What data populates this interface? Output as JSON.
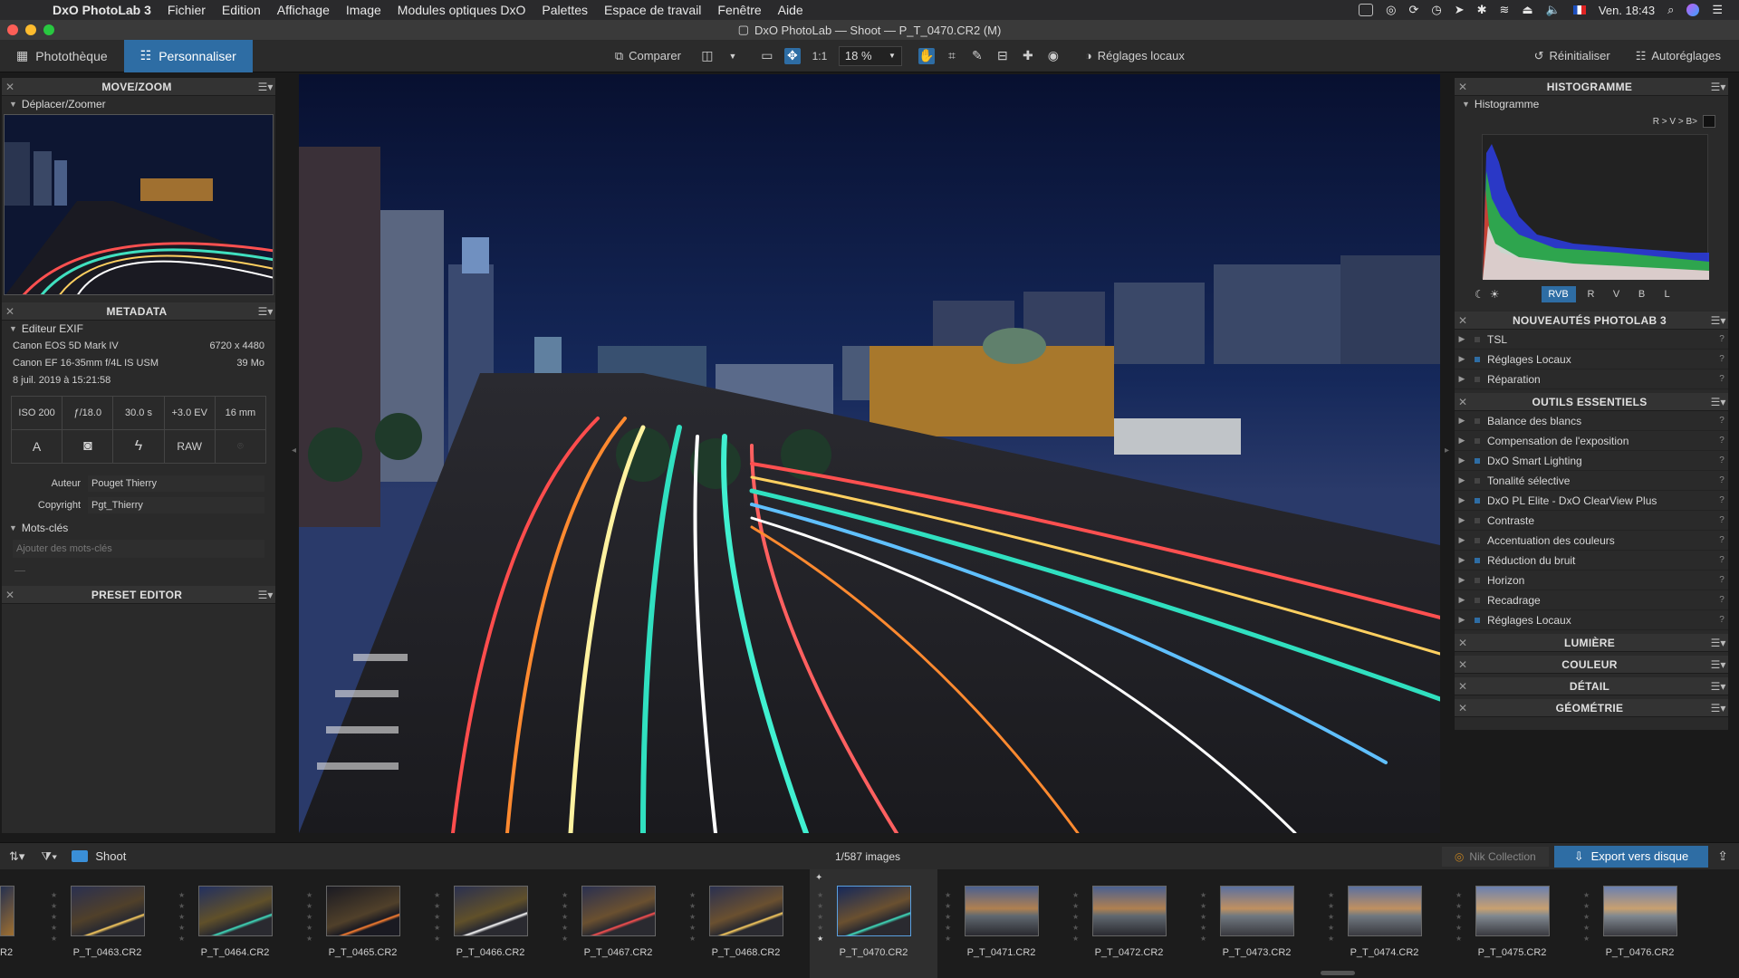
{
  "menubar": {
    "app_name": "DxO PhotoLab 3",
    "items": [
      "Fichier",
      "Edition",
      "Affichage",
      "Image",
      "Modules optiques DxO",
      "Palettes",
      "Espace de travail",
      "Fenêtre",
      "Aide"
    ],
    "clock": "Ven. 18:43"
  },
  "window": {
    "title": "DxO PhotoLab — Shoot — P_T_0470.CR2 (M)"
  },
  "toolbar": {
    "tab_library": "Photothèque",
    "tab_customize": "Personnaliser",
    "compare_label": "Comparer",
    "ratio_label": "1:1",
    "zoom_value": "18 %",
    "local_adjust_label": "Réglages locaux",
    "reset_label": "Réinitialiser",
    "auto_label": "Autoréglages"
  },
  "left": {
    "move_zoom_title": "MOVE/ZOOM",
    "move_zoom_sub": "Déplacer/Zoomer",
    "metadata_title": "METADATA",
    "exif_sub": "Editeur EXIF",
    "camera": "Canon EOS 5D Mark IV",
    "resolution": "6720 x 4480",
    "lens": "Canon EF 16-35mm f/4L IS USM",
    "size": "39 Mo",
    "date": "8 juil. 2019 à 15:21:58",
    "iso": "ISO 200",
    "aperture": "ƒ/18.0",
    "shutter": "30.0 s",
    "ev": "+3.0 EV",
    "focal": "16 mm",
    "mode": "A",
    "format": "RAW",
    "author_label": "Auteur",
    "author_value": "Pouget Thierry",
    "copyright_label": "Copyright",
    "copyright_value": "Pgt_Thierry",
    "keywords_sub": "Mots-clés",
    "keywords_placeholder": "Ajouter des mots-clés",
    "preset_title": "PRESET EDITOR"
  },
  "right": {
    "histogram_title": "HISTOGRAMME",
    "histogram_sub": "Histogramme",
    "clip_label": "R > V > B>",
    "channels": [
      "RVB",
      "R",
      "V",
      "B",
      "L"
    ],
    "new_title": "NOUVEAUTÉS PHOTOLAB 3",
    "new_items": [
      "TSL",
      "Réglages Locaux",
      "Réparation"
    ],
    "essential_title": "OUTILS ESSENTIELS",
    "essential_items": [
      "Balance des blancs",
      "Compensation de l'exposition",
      "DxO Smart Lighting",
      "Tonalité sélective",
      "DxO PL Elite - DxO ClearView Plus",
      "Contraste",
      "Accentuation des couleurs",
      "Réduction du bruit",
      "Horizon",
      "Recadrage",
      "Réglages Locaux"
    ],
    "lumiere_title": "LUMIÈRE",
    "couleur_title": "COULEUR",
    "detail_title": "DÉTAIL",
    "geometrie_title": "GÉOMÉTRIE"
  },
  "bottombar": {
    "folder": "Shoot",
    "count": "1/587 images",
    "nik_label": "Nik Collection",
    "export_label": "Export vers disque"
  },
  "filmstrip": {
    "first_partial": "R2",
    "items": [
      "P_T_0463.CR2",
      "P_T_0464.CR2",
      "P_T_0465.CR2",
      "P_T_0466.CR2",
      "P_T_0467.CR2",
      "P_T_0468.CR2",
      "P_T_0470.CR2",
      "P_T_0471.CR2",
      "P_T_0472.CR2",
      "P_T_0473.CR2",
      "P_T_0474.CR2",
      "P_T_0475.CR2",
      "P_T_0476.CR2"
    ]
  }
}
